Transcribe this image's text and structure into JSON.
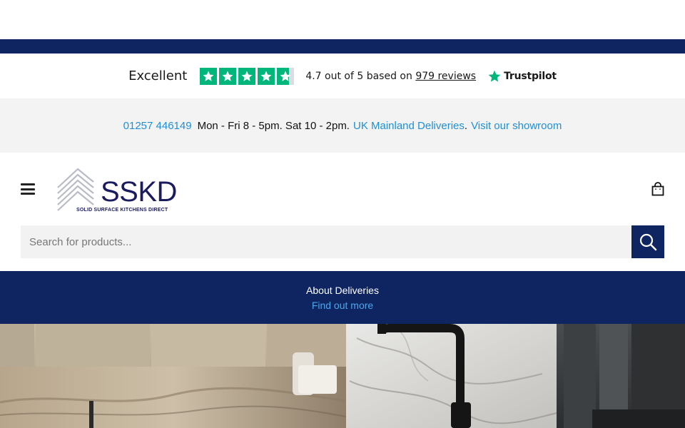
{
  "trustpilot": {
    "rating_word": "Excellent",
    "score_text": "4.7 out of 5 based on",
    "reviews_text": "979 reviews",
    "brand": "Trustpilot",
    "rating": 4.7,
    "star_color": "#00b67a"
  },
  "infobar": {
    "phone": "01257 446149",
    "hours": "Mon - Fri 8 - 5pm. Sat 10 - 2pm.",
    "deliveries_link": "UK Mainland Deliveries",
    "separator": ".",
    "showroom_link": "Visit our showroom",
    "link_color": "#1f8fd8"
  },
  "header": {
    "menu_icon": "hamburger-icon",
    "logo_text": "SSKD",
    "logo_subtitle": "SOLID SURFACE KITCHENS DIRECT",
    "cart_icon": "shopping-bag-icon"
  },
  "search": {
    "placeholder": "Search for products...",
    "value": "",
    "button_icon": "search-icon"
  },
  "promo": {
    "title": "About Deliveries",
    "link": "Find out more",
    "background": "#0e2561"
  },
  "colors": {
    "navy": "#0e2561",
    "brand_text": "#1b1c5f"
  }
}
